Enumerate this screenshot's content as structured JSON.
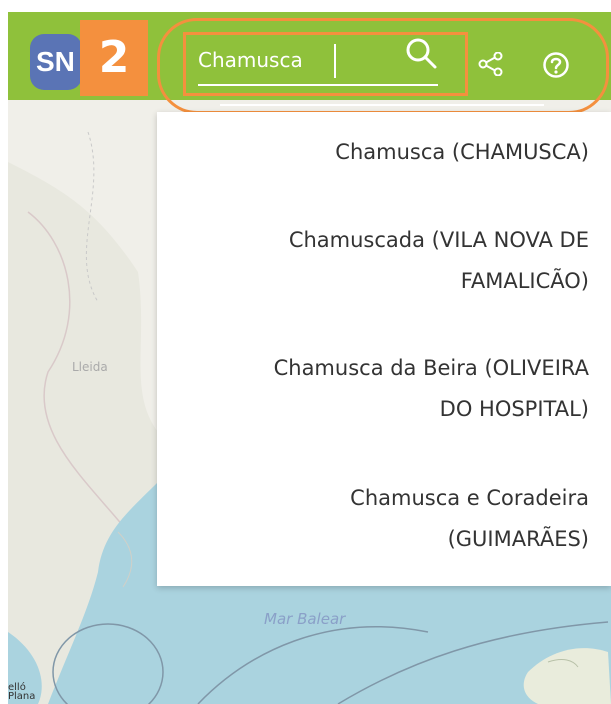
{
  "header": {
    "logo_text": "SN",
    "step_badge": "2",
    "search": {
      "value": "Chamusca",
      "placeholder": ""
    },
    "icons": [
      "search-icon",
      "share-icon",
      "help-icon"
    ]
  },
  "results": [
    {
      "line1": "Chamusca (CHAMUSCA)",
      "line2": ""
    },
    {
      "line1": "Chamuscada (VILA NOVA DE",
      "line2": "FAMALICÃO)"
    },
    {
      "line1": "Chamusca da Beira (OLIVEIRA",
      "line2": "DO HOSPITAL)"
    },
    {
      "line1": "Chamusca e Coradeira",
      "line2": "(GUIMARÃES)"
    }
  ],
  "map": {
    "sea_label": "Mar Balear",
    "city_label": "Lleida",
    "attribution_line1": "elló",
    "attribution_line2": "Plana"
  },
  "colors": {
    "header": "#8fc13b",
    "annotation": "#f4903e",
    "logo": "#5a74b5",
    "sea": "#aad3df",
    "land": "#f0efe9"
  }
}
